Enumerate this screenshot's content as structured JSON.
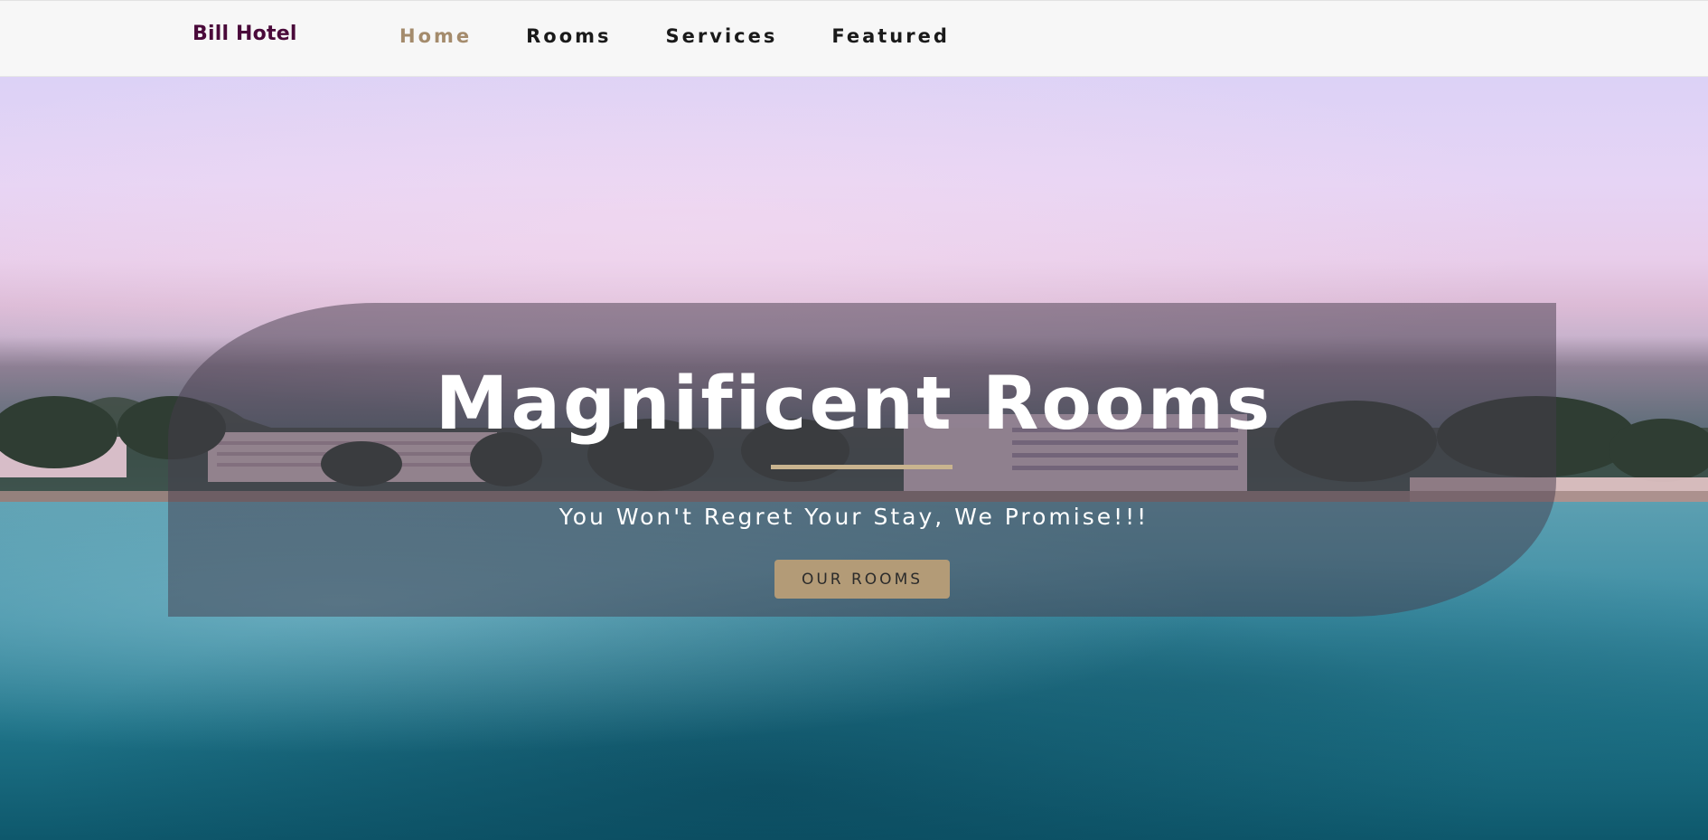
{
  "navbar": {
    "brand": "Bill Hotel",
    "links": [
      {
        "label": "Home",
        "active": true
      },
      {
        "label": "Rooms",
        "active": false
      },
      {
        "label": "Services",
        "active": false
      },
      {
        "label": "Featured",
        "active": false
      }
    ]
  },
  "hero": {
    "title": "Magnificent Rooms",
    "subtitle": "You Won't Regret Your Stay, We Promise!!!",
    "cta_label": "OUR ROOMS",
    "background_image": "beach-resort-shoreline-at-dusk-with-water-foreground"
  },
  "colors": {
    "brand": "#4a0a3a",
    "nav_active": "#a48b6c",
    "accent": "#b39b77",
    "divider": "#c9b48f"
  }
}
